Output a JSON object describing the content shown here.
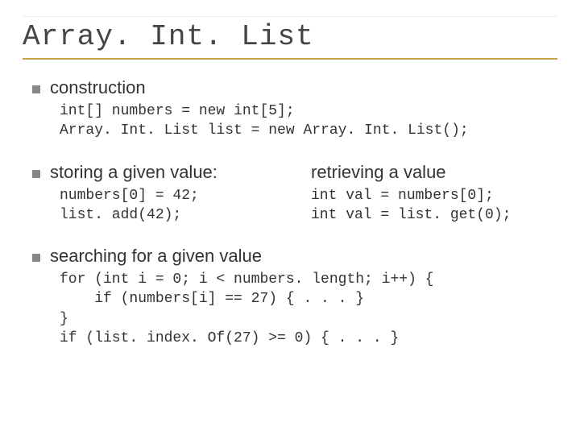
{
  "title": "Array. Int. List",
  "sections": {
    "construction": {
      "heading": "construction",
      "code": "int[] numbers = new int[5];\nArray. Int. List list = new Array. Int. List();"
    },
    "storing": {
      "heading": "storing a given value:",
      "code": "numbers[0] = 42;\nlist. add(42);"
    },
    "retrieving": {
      "heading": "retrieving a value",
      "code": "int val = numbers[0];\nint val = list. get(0);"
    },
    "searching": {
      "heading": "searching for a given value",
      "code": "for (int i = 0; i < numbers. length; i++) {\n    if (numbers[i] == 27) { . . . }\n}\nif (list. index. Of(27) >= 0) { . . . }"
    }
  }
}
